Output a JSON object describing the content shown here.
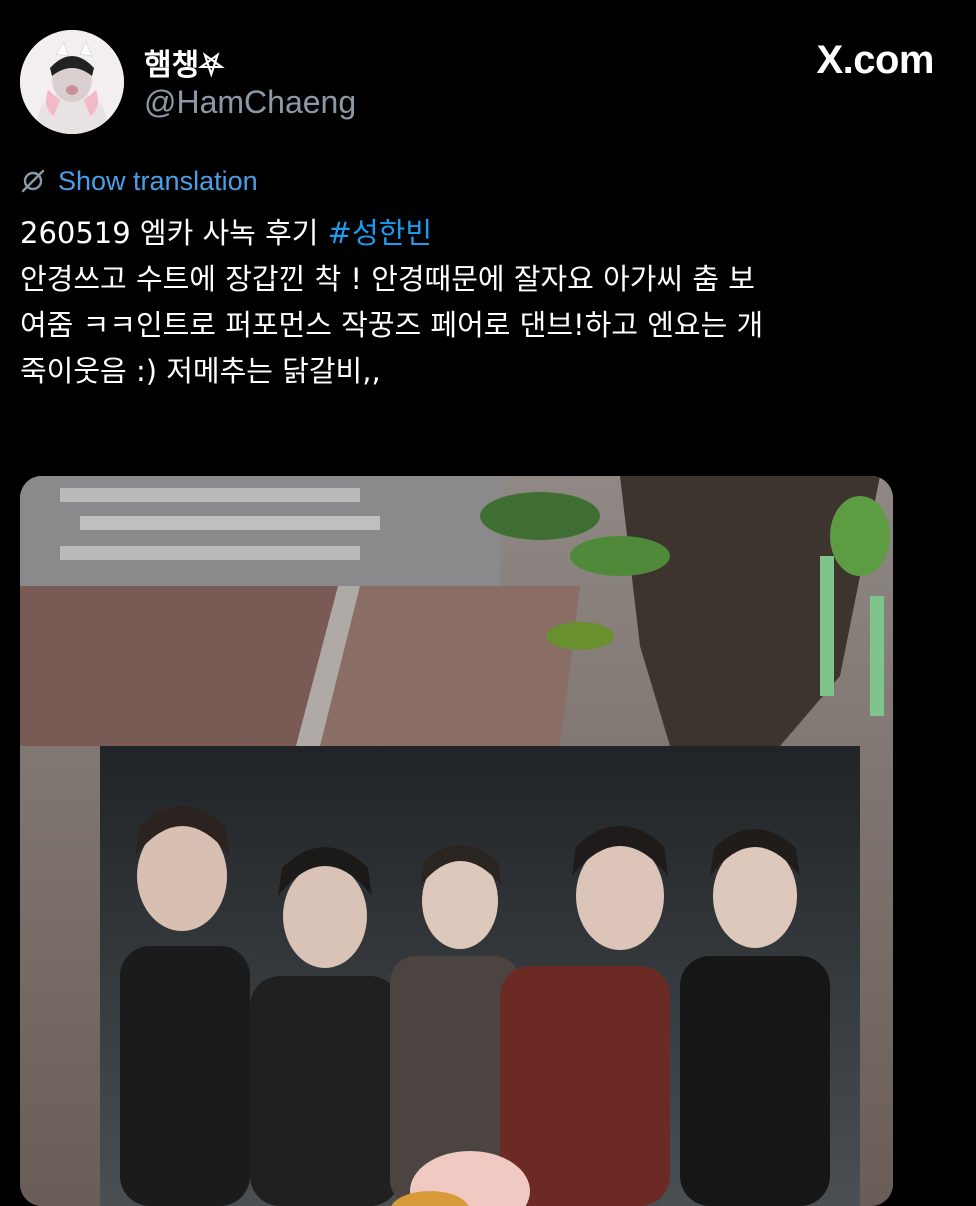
{
  "user": {
    "display_name": "햄챙⛧",
    "handle": "@HamChaeng",
    "avatar": "avatar-photo"
  },
  "brand": {
    "label": "X.com"
  },
  "translate": {
    "icon": "globe-slash-icon",
    "label": "Show translation"
  },
  "tweet": {
    "line1_prefix": "260519 엠카 사녹 후기 ",
    "hashtag": "#성한빈",
    "line2": "안경쓰고 수트에 장갑낀 착 ! 안경때문에 잘자요 아가씨 춤 보",
    "line3": "여줌 ㅋㅋ인트로 퍼포먼스 작꿍즈 페어로 댄브!하고 엔요는 개",
    "line4": "죽이웃음 :) 저메추는 닭갈비,,"
  },
  "media": {
    "type": "photo",
    "alt_icon": "photo-icon"
  },
  "colors": {
    "background": "#000000",
    "text": "#ffffff",
    "secondary": "#8b98a5",
    "accent": "#1d9bf0"
  }
}
